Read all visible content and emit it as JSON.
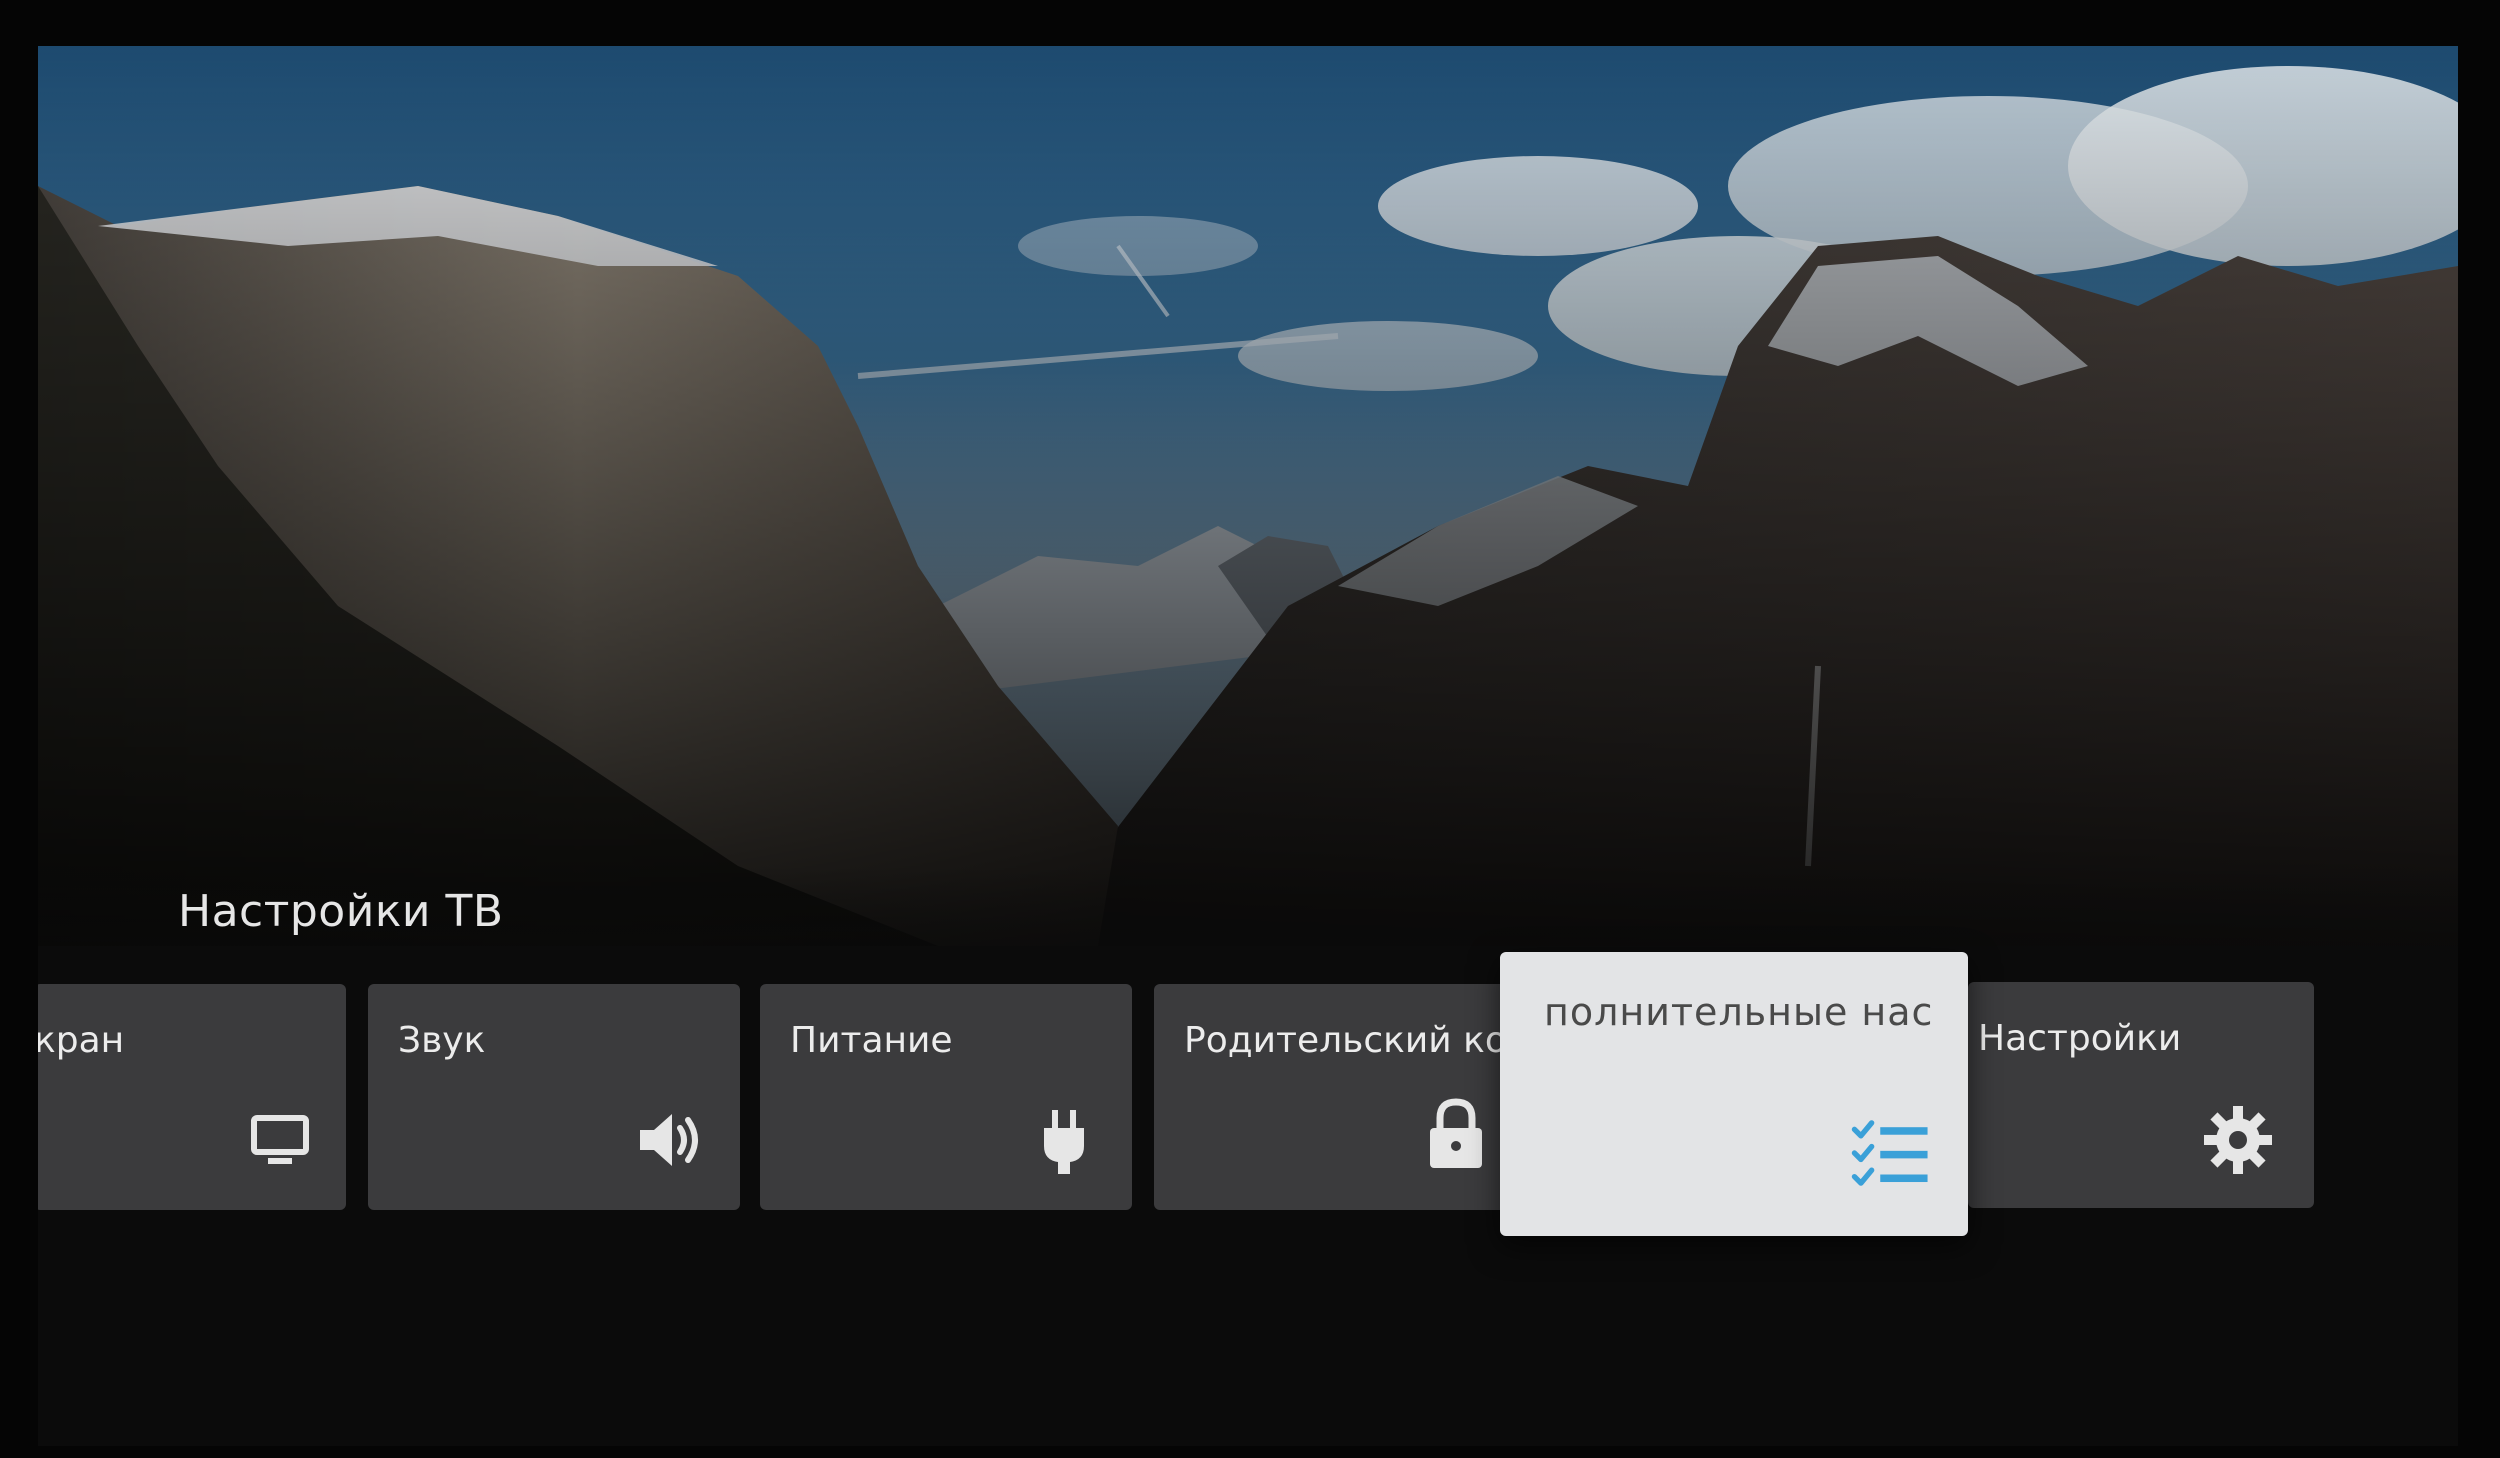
{
  "section_title": "Настройки ТВ",
  "cards": [
    {
      "label": "кран",
      "icon": "monitor-icon",
      "focused": false
    },
    {
      "label": "Звук",
      "icon": "speaker-icon",
      "focused": false
    },
    {
      "label": "Питание",
      "icon": "power-plug-icon",
      "focused": false
    },
    {
      "label": "Родительский ко..",
      "icon": "lock-icon",
      "focused": false
    },
    {
      "label": "полнительные нас",
      "icon": "checklist-icon",
      "focused": true
    },
    {
      "label": "Настройки",
      "icon": "gear-icon",
      "focused": false
    }
  ],
  "colors": {
    "card_bg": "#3b3b3d",
    "focused_card_bg": "#e3e4e6",
    "accent_icon": "#3aa0d8"
  }
}
